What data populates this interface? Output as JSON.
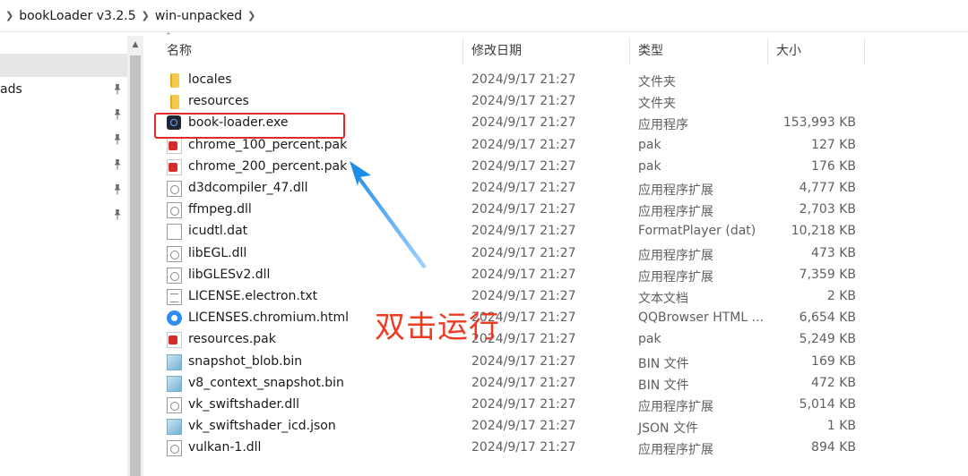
{
  "breadcrumb": {
    "items": [
      "bookLoader v3.2.5",
      "win-unpacked"
    ]
  },
  "nav": {
    "items": [
      {
        "label": ""
      },
      {
        "label": "ads"
      },
      {
        "label": ""
      },
      {
        "label": ""
      },
      {
        "label": ""
      },
      {
        "label": ""
      }
    ]
  },
  "columns": {
    "name": "名称",
    "date": "修改日期",
    "type": "类型",
    "size": "大小"
  },
  "files": [
    {
      "name": "locales",
      "date": "2024/9/17 21:27",
      "type": "文件夹",
      "size": "",
      "icon": "folder-icon"
    },
    {
      "name": "resources",
      "date": "2024/9/17 21:27",
      "type": "文件夹",
      "size": "",
      "icon": "folder-icon"
    },
    {
      "name": "book-loader.exe",
      "date": "2024/9/17 21:27",
      "type": "应用程序",
      "size": "153,993 KB",
      "icon": "exe-icon"
    },
    {
      "name": "chrome_100_percent.pak",
      "date": "2024/9/17 21:27",
      "type": "pak",
      "size": "127 KB",
      "icon": "pak-icon"
    },
    {
      "name": "chrome_200_percent.pak",
      "date": "2024/9/17 21:27",
      "type": "pak",
      "size": "176 KB",
      "icon": "pak-icon"
    },
    {
      "name": "d3dcompiler_47.dll",
      "date": "2024/9/17 21:27",
      "type": "应用程序扩展",
      "size": "4,777 KB",
      "icon": "dll-icon"
    },
    {
      "name": "ffmpeg.dll",
      "date": "2024/9/17 21:27",
      "type": "应用程序扩展",
      "size": "2,703 KB",
      "icon": "dll-icon"
    },
    {
      "name": "icudtl.dat",
      "date": "2024/9/17 21:27",
      "type": "FormatPlayer (dat)",
      "size": "10,218 KB",
      "icon": "file-icon"
    },
    {
      "name": "libEGL.dll",
      "date": "2024/9/17 21:27",
      "type": "应用程序扩展",
      "size": "473 KB",
      "icon": "dll-icon"
    },
    {
      "name": "libGLESv2.dll",
      "date": "2024/9/17 21:27",
      "type": "应用程序扩展",
      "size": "7,359 KB",
      "icon": "dll-icon"
    },
    {
      "name": "LICENSE.electron.txt",
      "date": "2024/9/17 21:27",
      "type": "文本文档",
      "size": "2 KB",
      "icon": "text-file-icon"
    },
    {
      "name": "LICENSES.chromium.html",
      "date": "2024/9/17 21:27",
      "type": "QQBrowser HTML ...",
      "size": "6,654 KB",
      "icon": "browser-html-icon"
    },
    {
      "name": "resources.pak",
      "date": "2024/9/17 21:27",
      "type": "pak",
      "size": "5,249 KB",
      "icon": "pak-icon"
    },
    {
      "name": "snapshot_blob.bin",
      "date": "2024/9/17 21:27",
      "type": "BIN 文件",
      "size": "169 KB",
      "icon": "bin-icon"
    },
    {
      "name": "v8_context_snapshot.bin",
      "date": "2024/9/17 21:27",
      "type": "BIN 文件",
      "size": "472 KB",
      "icon": "bin-icon"
    },
    {
      "name": "vk_swiftshader.dll",
      "date": "2024/9/17 21:27",
      "type": "应用程序扩展",
      "size": "5,014 KB",
      "icon": "dll-icon"
    },
    {
      "name": "vk_swiftshader_icd.json",
      "date": "2024/9/17 21:27",
      "type": "JSON 文件",
      "size": "1 KB",
      "icon": "bin-icon"
    },
    {
      "name": "vulkan-1.dll",
      "date": "2024/9/17 21:27",
      "type": "应用程序扩展",
      "size": "894 KB",
      "icon": "dll-icon"
    }
  ],
  "annotation": {
    "text": "双击运行",
    "color": "#ee3b24"
  }
}
